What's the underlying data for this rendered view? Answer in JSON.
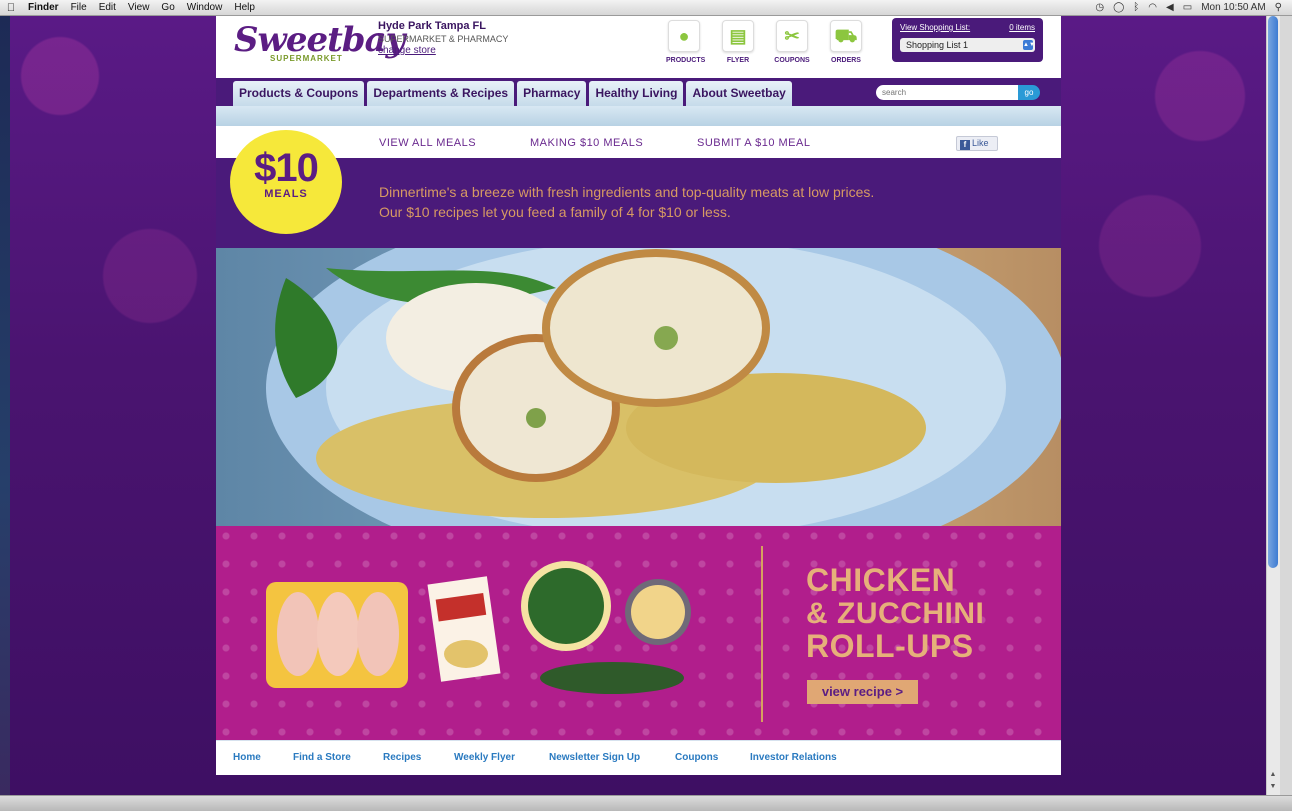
{
  "menubar": {
    "apple": "",
    "items": [
      "Finder",
      "File",
      "Edit",
      "View",
      "Go",
      "Window",
      "Help"
    ],
    "clock": "Mon 10:50 AM"
  },
  "header": {
    "logo_word": "Sweetbay",
    "logo_sub": "SUPERMARKET",
    "store_city": "Hyde Park Tampa FL",
    "store_type": "SUPERMARKET & PHARMACY",
    "change_store": "change store",
    "quick_icons": [
      {
        "label": "PRODUCTS",
        "icon": "apple-icon",
        "glyph": "●"
      },
      {
        "label": "FLYER",
        "icon": "flyer-icon",
        "glyph": "▤"
      },
      {
        "label": "COUPONS",
        "icon": "scissors-icon",
        "glyph": "✂"
      },
      {
        "label": "ORDERS",
        "icon": "cart-icon",
        "glyph": "⛟"
      }
    ],
    "shopping_list": {
      "view_label": "View Shopping List:",
      "count": "0 items",
      "selected": "Shopping List 1"
    }
  },
  "nav": {
    "tabs": [
      "Products & Coupons",
      "Departments & Recipes",
      "Pharmacy",
      "Healthy Living",
      "About Sweetbay"
    ],
    "search_placeholder": "search",
    "go_label": "go"
  },
  "submenu": {
    "links": [
      "VIEW ALL MEALS",
      "MAKING $10 MEALS",
      "SUBMIT A $10 MEAL"
    ],
    "like_label": "Like",
    "like_icon": "f"
  },
  "intro": {
    "badge_amount": "$10",
    "badge_label": "MEALS",
    "line1": "Dinnertime's a breeze with fresh ingredients and top-quality meats at low prices.",
    "line2": "Our $10 recipes let you feed a family of 4 for $10 or less."
  },
  "feature": {
    "title_line1": "CHICKEN",
    "title_line2": "& ZUCCHINI",
    "title_line3": "ROLL-UPS",
    "button": "view recipe >"
  },
  "footer": {
    "links": [
      "Home",
      "Find a Store",
      "Recipes",
      "Weekly Flyer",
      "Newsletter Sign Up",
      "Coupons",
      "Investor Relations"
    ]
  },
  "colors": {
    "brand_purple": "#4a1a7a",
    "feature_magenta": "#b11e8c",
    "badge_yellow": "#f6e83a",
    "footer_link_blue": "#2a7ac0"
  }
}
